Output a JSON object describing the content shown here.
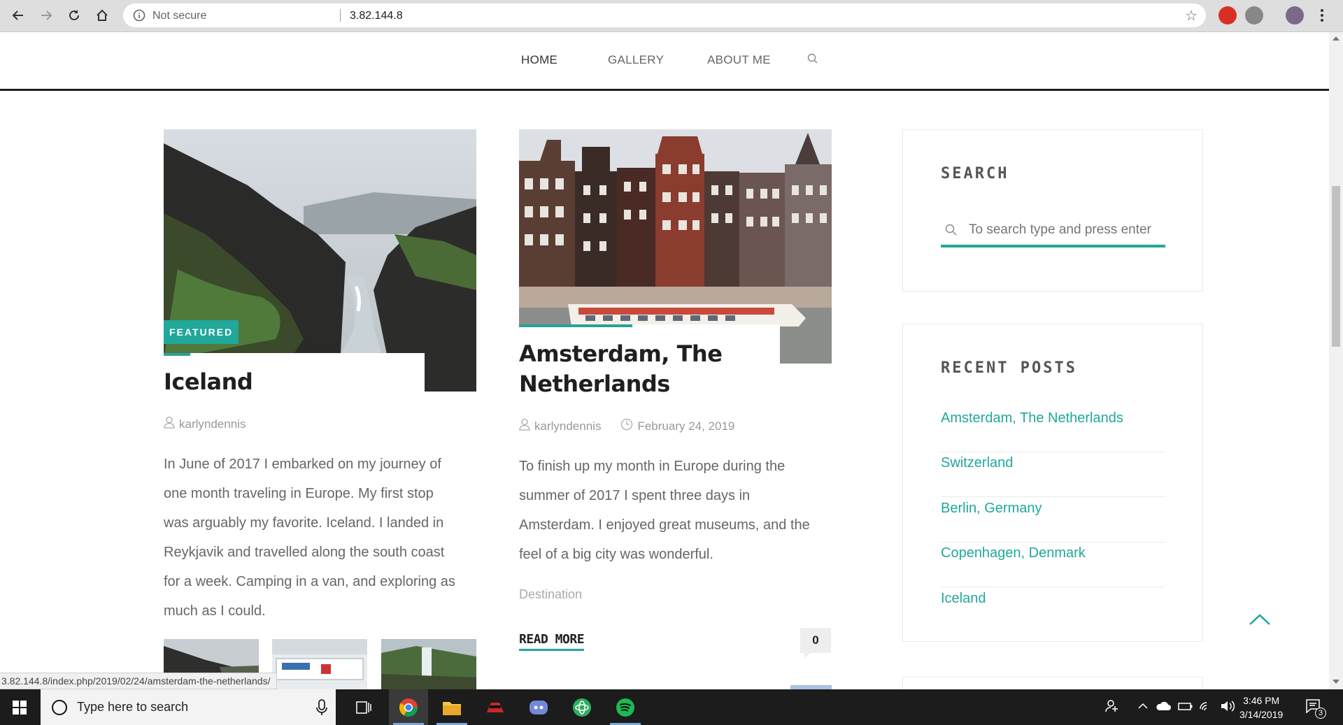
{
  "browser": {
    "security_label": "Not secure",
    "url": "3.82.144.8",
    "status_url": "3.82.144.8/index.php/2019/02/24/amsterdam-the-netherlands/"
  },
  "site_nav": {
    "items": [
      {
        "label": "HOME",
        "active": true
      },
      {
        "label": "GALLERY",
        "active": false
      },
      {
        "label": "ABOUT ME",
        "active": false
      }
    ]
  },
  "posts": [
    {
      "badge": "FEATURED",
      "title_lines": [
        "Iceland"
      ],
      "author": "karlyndennis",
      "excerpt_lines": [
        "In June of 2017 I embarked on my journey of",
        "one month traveling in Europe. My first stop",
        "was arguably my favorite. Iceland. I landed in",
        "Reykjavik and travelled along the south coast",
        "for a week. Camping in a van, and exploring as",
        "much as I could."
      ]
    },
    {
      "title_lines": [
        "Amsterdam, The",
        "Netherlands"
      ],
      "author": "karlyndennis",
      "date": "February 24, 2019",
      "excerpt_lines": [
        "To finish up my month in Europe during the",
        "summer of 2017 I spent three days in",
        "Amsterdam. I enjoyed great museums, and the",
        "feel of a big city was wonderful."
      ],
      "category": "Destination",
      "read_more": "READ MORE",
      "comment_count": "0"
    }
  ],
  "sidebar": {
    "search": {
      "title": "SEARCH",
      "placeholder": "To search type and press enter"
    },
    "recent_posts": {
      "title": "RECENT POSTS",
      "items": [
        "Amsterdam, The Netherlands",
        "Switzerland",
        "Berlin, Germany",
        "Copenhagen, Denmark",
        "Iceland"
      ]
    }
  },
  "taskbar": {
    "search_placeholder": "Type here to search",
    "time": "3:46 PM",
    "date": "3/14/2019",
    "notification_count": "3"
  },
  "colors": {
    "accent": "#20a89a",
    "heading": "#1f1f1f"
  },
  "icons": [
    "back-arrow-icon",
    "forward-arrow-icon",
    "reload-icon",
    "home-icon",
    "info-icon",
    "star-icon",
    "search-icon",
    "user-icon",
    "clock-icon",
    "chevron-up-icon",
    "windows-icon",
    "mic-icon",
    "task-view-icon",
    "chrome-icon",
    "folder-icon",
    "discord-icon",
    "spotify-icon",
    "cloud-icon",
    "wifi-icon",
    "volume-icon",
    "battery-icon",
    "notification-icon"
  ]
}
